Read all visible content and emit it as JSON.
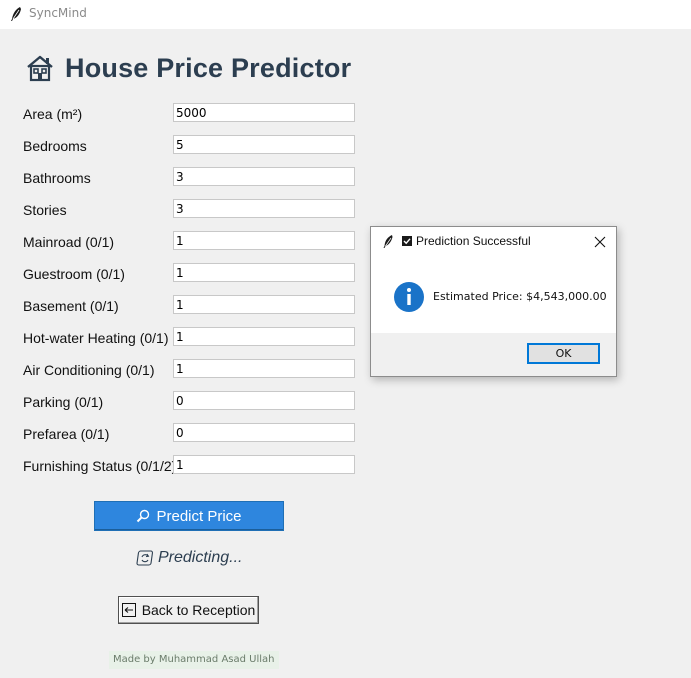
{
  "window": {
    "title": "SyncMind"
  },
  "header": {
    "title": "House Price Predictor"
  },
  "form": {
    "fields": [
      {
        "label": "Area (m²)",
        "value": "5000"
      },
      {
        "label": "Bedrooms",
        "value": "5"
      },
      {
        "label": "Bathrooms",
        "value": "3"
      },
      {
        "label": "Stories",
        "value": "3"
      },
      {
        "label": "Mainroad (0/1)",
        "value": "1"
      },
      {
        "label": "Guestroom (0/1)",
        "value": "1"
      },
      {
        "label": "Basement (0/1)",
        "value": "1"
      },
      {
        "label": "Hot-water Heating (0/1)",
        "value": "1"
      },
      {
        "label": "Air Conditioning (0/1)",
        "value": "1"
      },
      {
        "label": "Parking (0/1)",
        "value": "0"
      },
      {
        "label": "Prefarea (0/1)",
        "value": "0"
      },
      {
        "label": "Furnishing Status (0/1/2)",
        "value": "1"
      }
    ]
  },
  "predict_button": {
    "label": "Predict Price"
  },
  "status": {
    "text": "Predicting..."
  },
  "back_button": {
    "label": "Back to Reception"
  },
  "footer": {
    "text": "Made by Muhammad Asad Ullah"
  },
  "dialog": {
    "title": "Prediction Successful",
    "message": "Estimated Price: $4,543,000.00",
    "ok_label": "OK"
  },
  "colors": {
    "accent": "#2e86de",
    "title_text": "#2c3e50",
    "info_icon": "#1a73c8",
    "background": "#f0f0f0"
  },
  "icons": {
    "app": "feather-icon",
    "header": "house-icon",
    "predict": "magnifier-icon",
    "status": "refresh-icon",
    "back": "back-arrow-icon",
    "dialog_check": "checkbox-icon",
    "dialog_info": "info-icon",
    "dialog_close": "close-icon"
  }
}
